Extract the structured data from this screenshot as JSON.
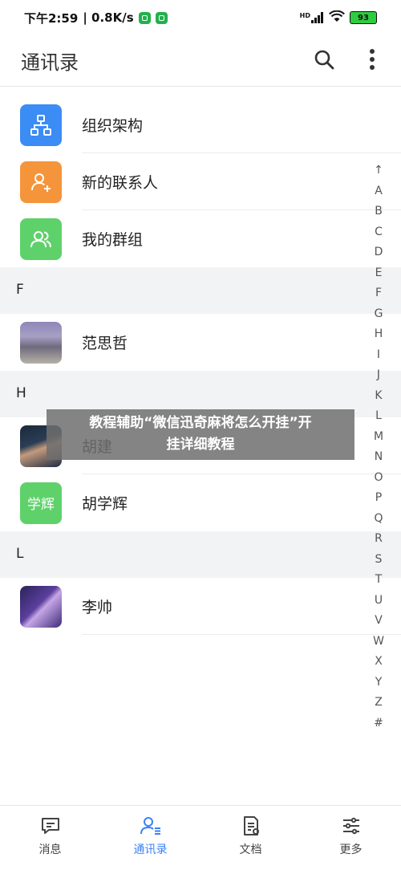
{
  "status_bar": {
    "time": "下午2:59",
    "network_speed": "| 0.8K/s",
    "hd_label": "HD",
    "battery": "93"
  },
  "header": {
    "title": "通讯录"
  },
  "quick_items": [
    {
      "label": "组织架构",
      "icon": "org-chart-icon",
      "color": "#3b8cf5"
    },
    {
      "label": "新的联系人",
      "icon": "add-user-icon",
      "color": "#f5953b"
    },
    {
      "label": "我的群组",
      "icon": "group-icon",
      "color": "#5fd16b"
    }
  ],
  "sections": [
    {
      "letter": "F",
      "contacts": [
        {
          "name": "范思哲"
        }
      ]
    },
    {
      "letter": "H",
      "contacts": [
        {
          "name": "胡建"
        },
        {
          "name": "胡学辉",
          "avatar_text": "学辉"
        }
      ]
    },
    {
      "letter": "L",
      "contacts": [
        {
          "name": "李帅"
        }
      ]
    }
  ],
  "alphabet_index": [
    "↑",
    "A",
    "B",
    "C",
    "D",
    "E",
    "F",
    "G",
    "H",
    "I",
    "J",
    "K",
    "L",
    "M",
    "N",
    "O",
    "P",
    "Q",
    "R",
    "S",
    "T",
    "U",
    "V",
    "W",
    "X",
    "Y",
    "Z",
    "#"
  ],
  "overlay": {
    "line1": "教程辅助“微信迅奇麻将怎么开挂”开",
    "line2": "挂详细教程"
  },
  "bottom_nav": {
    "tabs": [
      {
        "label": "消息",
        "icon": "message-icon"
      },
      {
        "label": "通讯录",
        "icon": "contacts-icon",
        "active": true
      },
      {
        "label": "文档",
        "icon": "document-icon"
      },
      {
        "label": "更多",
        "icon": "sliders-icon"
      }
    ]
  },
  "colors": {
    "accent": "#3b82f6",
    "section_bg": "#f2f3f5"
  }
}
